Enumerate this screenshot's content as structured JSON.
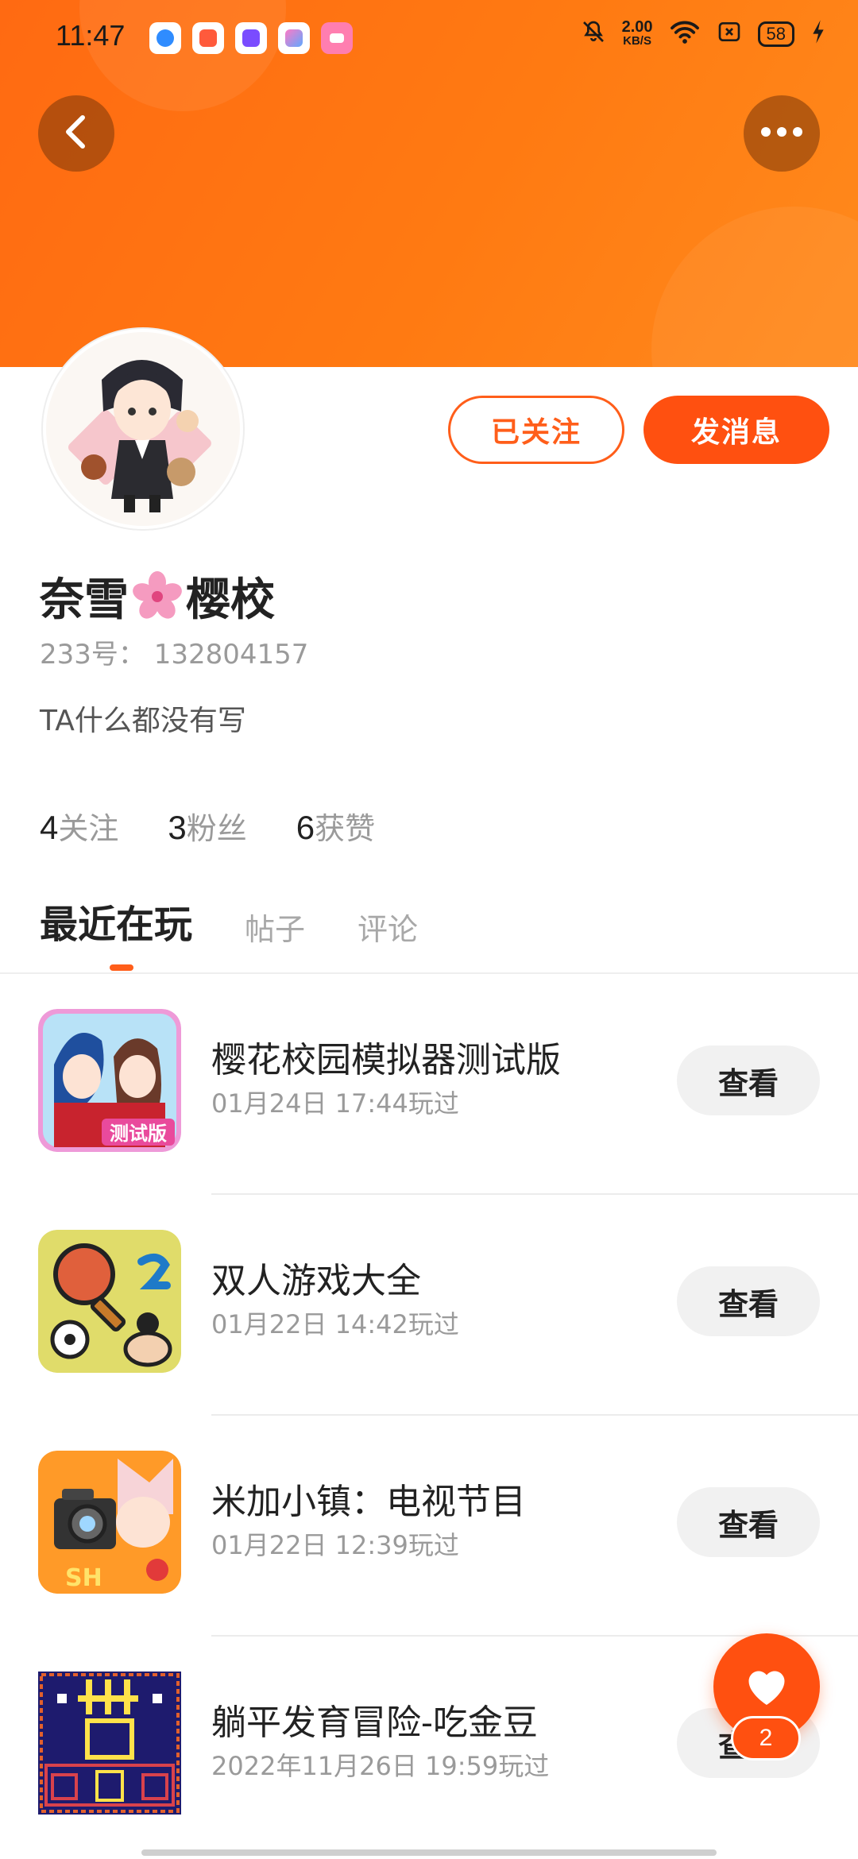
{
  "status_bar": {
    "time": "11:47",
    "net_speed_value": "2.00",
    "net_speed_unit": "KB/S",
    "battery": "58"
  },
  "header": {
    "back_icon": "chevron-left-icon",
    "more_icon": "more-dots-icon",
    "banner_color": "#ff6a12"
  },
  "profile": {
    "name_part1": "奈雪",
    "name_part2": "樱校",
    "uid": "233号： 132804157",
    "bio": "TA什么都没有写",
    "follow_button": "已关注",
    "message_button": "发消息",
    "stats": [
      {
        "num": "4",
        "label": "关注"
      },
      {
        "num": "3",
        "label": "粉丝"
      },
      {
        "num": "6",
        "label": "获赞"
      }
    ]
  },
  "tabs": [
    {
      "label": "最近在玩",
      "active": true
    },
    {
      "label": "帖子",
      "active": false
    },
    {
      "label": "评论",
      "active": false
    }
  ],
  "games": [
    {
      "title": "樱花校园模拟器测试版",
      "time": "01月24日  17:44玩过",
      "button": "查看",
      "icon_badge": "测试版"
    },
    {
      "title": "双人游戏大全",
      "time": "01月22日  14:42玩过",
      "button": "查看"
    },
    {
      "title": "米加小镇：电视节目",
      "time": "01月22日  12:39玩过",
      "button": "查看"
    },
    {
      "title": "躺平发育冒险-吃金豆",
      "time": "2022年11月26日  19:59玩过",
      "button": "查看"
    }
  ],
  "like_fab": {
    "count": "2",
    "accent": "#ff5010"
  }
}
